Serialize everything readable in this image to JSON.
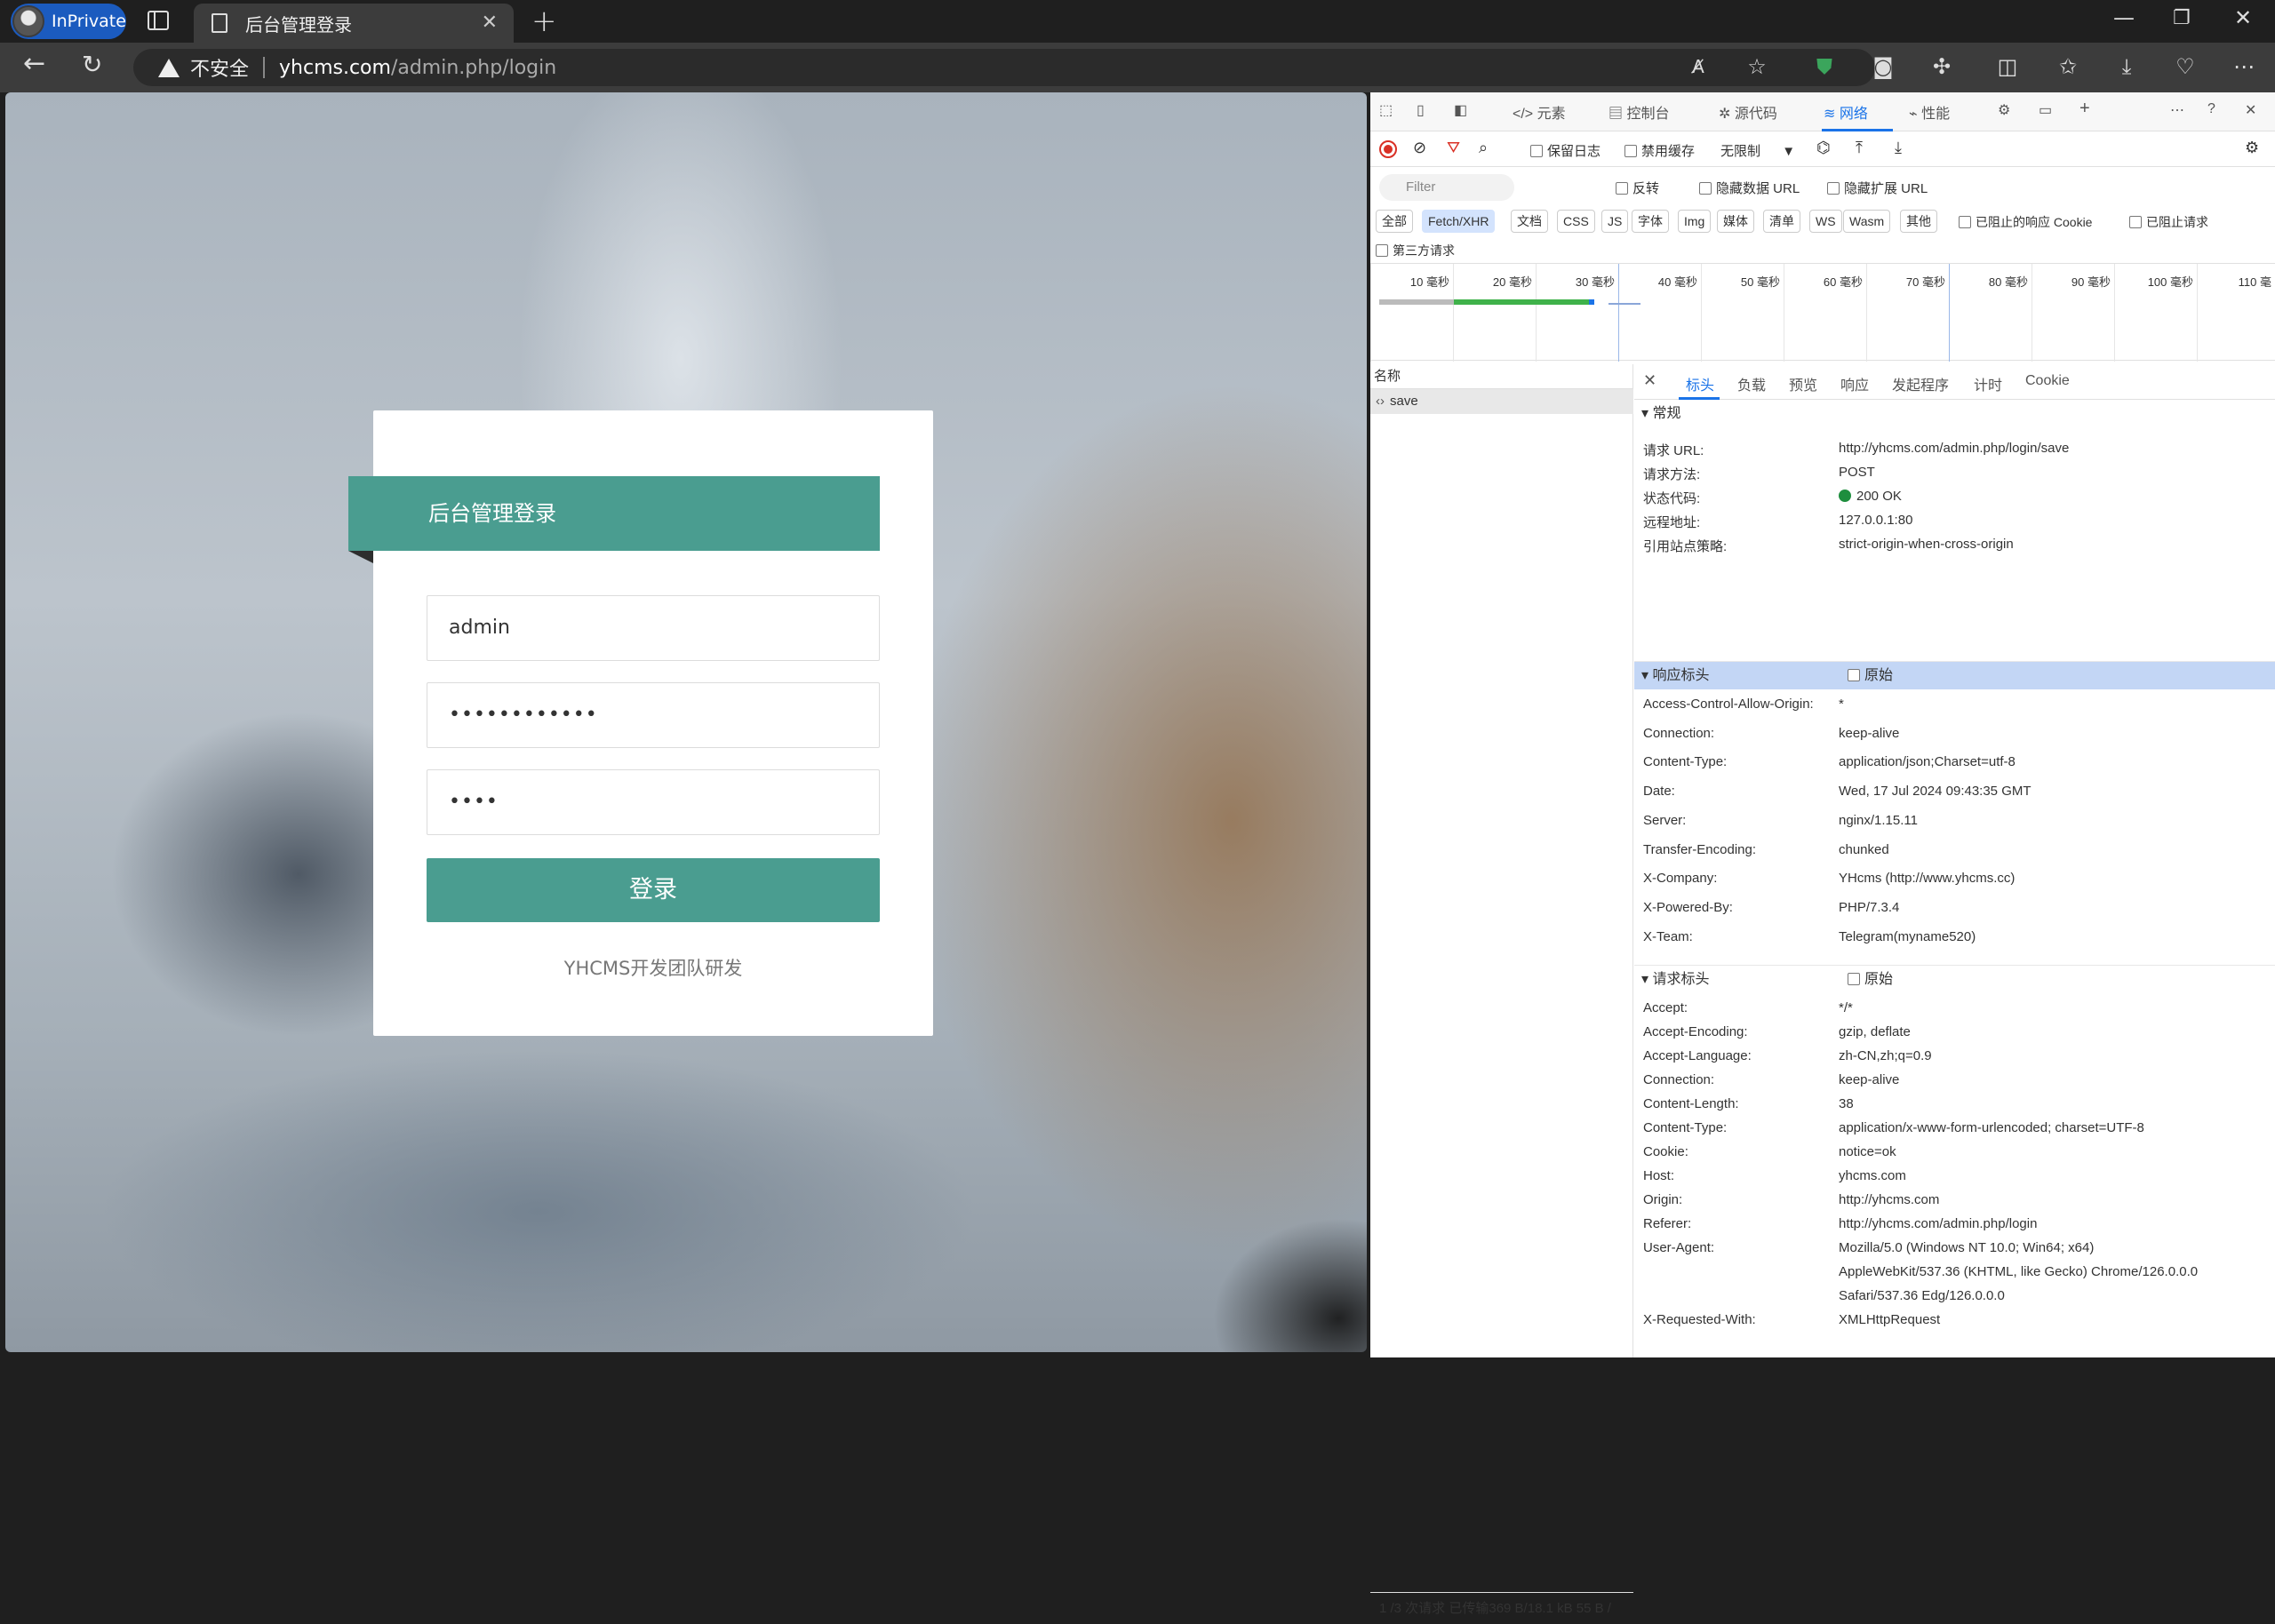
{
  "browser": {
    "inprivate_label": "InPrivate",
    "tab_title": "后台管理登录",
    "security_label": "不安全",
    "url_host": "yhcms.com",
    "url_path": "/admin.php/login"
  },
  "login": {
    "title": "后台管理登录",
    "username": "admin",
    "password_mask": "••••••••••••",
    "captcha_mask": "••••",
    "submit_label": "登录",
    "credit": "YHCMS开发团队研发"
  },
  "devtools": {
    "tabs": [
      "元素",
      "控制台",
      "源代码",
      "网络",
      "性能"
    ],
    "selected_tab": "网络",
    "toolbar": {
      "preserve_log": "保留日志",
      "disable_cache": "禁用缓存",
      "throttle": "无限制"
    },
    "filter_placeholder": "Filter",
    "filter_options": {
      "invert": "反转",
      "hide_data_url": "隐藏数据 URL",
      "hide_ext_url": "隐藏扩展 URL"
    },
    "type_chips": [
      "全部",
      "Fetch/XHR",
      "文档",
      "CSS",
      "JS",
      "字体",
      "Img",
      "媒体",
      "清单",
      "WS",
      "Wasm",
      "其他"
    ],
    "blocked_cookie": "已阻止的响应 Cookie",
    "blocked_requests": "已阻止请求",
    "third_party": "第三方请求",
    "timeline_ticks": [
      "10 毫秒",
      "20 毫秒",
      "30 毫秒",
      "40 毫秒",
      "50 毫秒",
      "60 毫秒",
      "70 毫秒",
      "80 毫秒",
      "90 毫秒",
      "100 毫秒",
      "110 毫"
    ],
    "name_header": "名称",
    "request_name": "save",
    "status_bar": "1 /3 次请求  已传输369 B/18.1 kB  55 B /",
    "detail_tabs": [
      "标头",
      "负载",
      "预览",
      "响应",
      "发起程序",
      "计时",
      "Cookie"
    ],
    "general_title": "常规",
    "general": [
      {
        "k": "请求 URL:",
        "v": "http://yhcms.com/admin.php/login/save"
      },
      {
        "k": "请求方法:",
        "v": "POST"
      },
      {
        "k": "状态代码:",
        "v": "200 OK"
      },
      {
        "k": "远程地址:",
        "v": "127.0.0.1:80"
      },
      {
        "k": "引用站点策略:",
        "v": "strict-origin-when-cross-origin"
      }
    ],
    "response_title": "响应标头",
    "raw_label": "原始",
    "response": [
      {
        "k": "Access-Control-Allow-Origin:",
        "v": "*"
      },
      {
        "k": "Connection:",
        "v": "keep-alive"
      },
      {
        "k": "Content-Type:",
        "v": "application/json;Charset=utf-8"
      },
      {
        "k": "Date:",
        "v": "Wed, 17 Jul 2024 09:43:35 GMT"
      },
      {
        "k": "Server:",
        "v": "nginx/1.15.11"
      },
      {
        "k": "Transfer-Encoding:",
        "v": "chunked"
      },
      {
        "k": "X-Company:",
        "v": "YHcms (http://www.yhcms.cc)"
      },
      {
        "k": "X-Powered-By:",
        "v": "PHP/7.3.4"
      },
      {
        "k": "X-Team:",
        "v": "Telegram(myname520)"
      }
    ],
    "request_title": "请求标头",
    "request": [
      {
        "k": "Accept:",
        "v": "*/*"
      },
      {
        "k": "Accept-Encoding:",
        "v": "gzip, deflate"
      },
      {
        "k": "Accept-Language:",
        "v": "zh-CN,zh;q=0.9"
      },
      {
        "k": "Connection:",
        "v": "keep-alive"
      },
      {
        "k": "Content-Length:",
        "v": "38"
      },
      {
        "k": "Content-Type:",
        "v": "application/x-www-form-urlencoded; charset=UTF-8"
      },
      {
        "k": "Cookie:",
        "v": "notice=ok"
      },
      {
        "k": "Host:",
        "v": "yhcms.com"
      },
      {
        "k": "Origin:",
        "v": "http://yhcms.com"
      },
      {
        "k": "Referer:",
        "v": "http://yhcms.com/admin.php/login"
      },
      {
        "k": "User-Agent:",
        "v": "Mozilla/5.0 (Windows NT 10.0; Win64; x64)"
      },
      {
        "k": "",
        "v": "AppleWebKit/537.36 (KHTML, like Gecko) Chrome/126.0.0.0"
      },
      {
        "k": "",
        "v": "Safari/537.36 Edg/126.0.0.0"
      },
      {
        "k": "X-Requested-With:",
        "v": "XMLHttpRequest"
      }
    ]
  }
}
